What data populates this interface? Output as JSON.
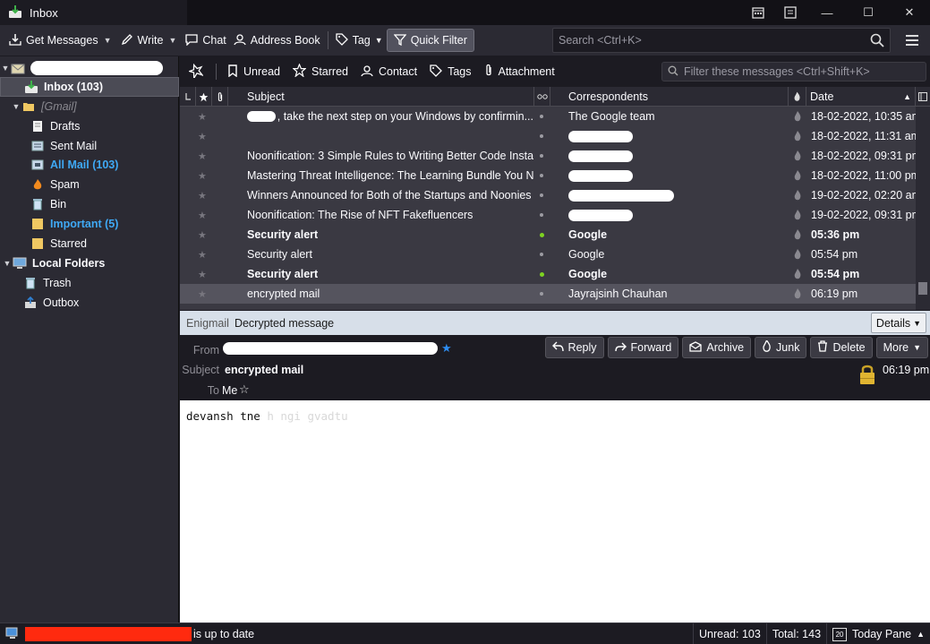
{
  "window": {
    "tab_title": "Inbox",
    "controls": {
      "calendar": "calendar-icon",
      "tasks": "tasks-icon",
      "minimize": "minimize-icon",
      "maximize": "maximize-icon",
      "close": "close-icon"
    }
  },
  "toolbar": {
    "get_messages": "Get Messages",
    "write": "Write",
    "chat": "Chat",
    "address_book": "Address Book",
    "tag": "Tag",
    "quick_filter": "Quick Filter",
    "search_placeholder": "Search <Ctrl+K>"
  },
  "folders": {
    "account_redacted": true,
    "items": [
      {
        "label": "Inbox (103)",
        "icon": "inbox-icon",
        "selected": true,
        "bold": true
      },
      {
        "label": "[Gmail]",
        "icon": "folder-icon",
        "muted": true
      },
      {
        "label": "Drafts",
        "icon": "drafts-icon"
      },
      {
        "label": "Sent Mail",
        "icon": "sent-icon"
      },
      {
        "label": "All Mail (103)",
        "icon": "archive-icon",
        "blue": true
      },
      {
        "label": "Spam",
        "icon": "spam-icon"
      },
      {
        "label": "Bin",
        "icon": "bin-icon"
      },
      {
        "label": "Important (5)",
        "icon": "folder-icon",
        "blue": true
      },
      {
        "label": "Starred",
        "icon": "folder-icon"
      },
      {
        "label": "Local Folders",
        "icon": "computer-icon",
        "bold": true
      },
      {
        "label": "Trash",
        "icon": "trash-icon"
      },
      {
        "label": "Outbox",
        "icon": "outbox-icon"
      }
    ]
  },
  "quickfilter": {
    "unread": "Unread",
    "starred": "Starred",
    "contact": "Contact",
    "tags": "Tags",
    "attachment": "Attachment",
    "filter_placeholder": "Filter these messages <Ctrl+Shift+K>"
  },
  "thread_columns": {
    "subject": "Subject",
    "correspondents": "Correspondents",
    "date": "Date"
  },
  "messages": [
    {
      "subject": ", take the next step on your Windows by confirmin...",
      "subject_redacted": true,
      "correspondent": "The Google team",
      "date": "18-02-2022, 10:35 am",
      "unread": false,
      "dot": "grey"
    },
    {
      "subject": "",
      "correspondent": "",
      "correspondent_redacted": true,
      "date": "18-02-2022, 11:31 am",
      "unread": false,
      "dot": "grey"
    },
    {
      "subject": "Noonification: 3 Simple Rules to Writing Better Code Instan...",
      "correspondent": "",
      "correspondent_redacted": true,
      "date": "18-02-2022, 09:31 pm",
      "unread": false,
      "dot": "grey"
    },
    {
      "subject": "Mastering Threat Intelligence: The Learning Bundle You Ne...",
      "correspondent": "",
      "correspondent_redacted": true,
      "date": "18-02-2022, 11:00 pm",
      "unread": false,
      "dot": "grey"
    },
    {
      "subject": "Winners Announced for Both of the Startups and Noonies ...",
      "correspondent": "",
      "correspondent_redacted": true,
      "date": "19-02-2022, 02:20 am",
      "unread": false,
      "dot": "grey"
    },
    {
      "subject": "Noonification: The Rise of NFT Fakefluencers",
      "correspondent": "",
      "correspondent_redacted": true,
      "date": "19-02-2022, 09:31 pm",
      "unread": false,
      "dot": "grey"
    },
    {
      "subject": "Security alert",
      "correspondent": "Google",
      "date": "05:36 pm",
      "unread": true,
      "dot": "green"
    },
    {
      "subject": "Security alert",
      "correspondent": "Google",
      "date": "05:54 pm",
      "unread": false,
      "dot": "grey"
    },
    {
      "subject": "Security alert",
      "correspondent": "Google",
      "date": "05:54 pm",
      "unread": true,
      "dot": "green"
    },
    {
      "subject": "encrypted mail",
      "correspondent": "Jayrajsinh Chauhan",
      "date": "06:19 pm",
      "unread": false,
      "dot": "grey",
      "selected": true
    }
  ],
  "enigmail": {
    "label": "Enigmail",
    "status": "Decrypted message",
    "details": "Details"
  },
  "header": {
    "from_label": "From",
    "subject_label": "Subject",
    "subject": "encrypted mail",
    "to_label": "To",
    "to": "Me",
    "time": "06:19 pm",
    "buttons": {
      "reply": "Reply",
      "forward": "Forward",
      "archive": "Archive",
      "junk": "Junk",
      "delete": "Delete",
      "more": "More"
    }
  },
  "body": {
    "visible": "devansh tne",
    "faded": "h   ngi gvadtu"
  },
  "status": {
    "text": "is up to date",
    "unread": "Unread: 103",
    "total": "Total: 143",
    "today_pane": "Today Pane",
    "today_day": "20"
  },
  "colors": {
    "accent_blue": "#3fa9f5",
    "unread_dot": "#7ed321",
    "redaction": "#ff2a0f"
  }
}
